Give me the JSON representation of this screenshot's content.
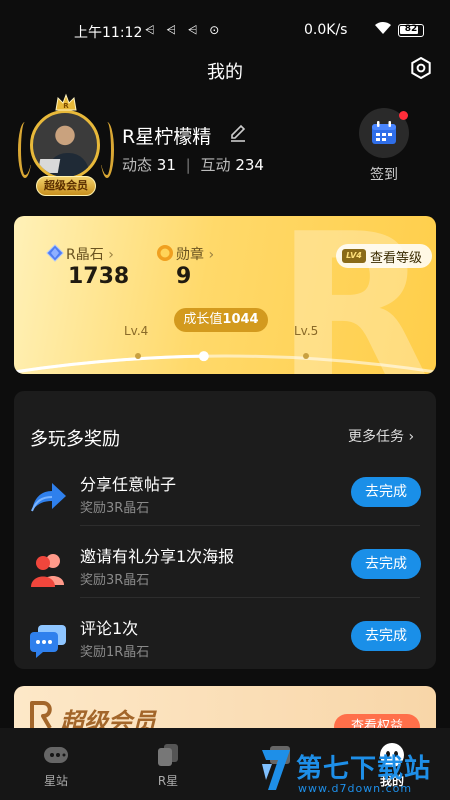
{
  "status_bar": {
    "time": "上午11:12",
    "notifications": "⩤ ⩤ ⩤ ⊙",
    "network_speed": "0.0K/s",
    "battery": "82",
    "battery_level": 0.82
  },
  "header": {
    "title": "我的"
  },
  "profile": {
    "username": "R星柠檬精",
    "badge": "超级会员",
    "stats": {
      "dongtai_label": "动态",
      "dongtai_value": "31",
      "hudong_label": "互动",
      "hudong_value": "234"
    },
    "signin_label": "签到"
  },
  "gold_card": {
    "gem_label": "R晶石",
    "gem_value": "1738",
    "medal_label": "勋章",
    "medal_value": "9",
    "level_badge": "LV4",
    "level_link": "查看等级",
    "growth_label": "成长值",
    "growth_value": "1044",
    "level_current": "Lv.4",
    "level_next": "Lv.5",
    "progress": 0.45
  },
  "tasks": {
    "title": "多玩多奖励",
    "more": "更多任务",
    "items": [
      {
        "title": "分享任意帖子",
        "reward": "奖励3R晶石",
        "button": "去完成",
        "icon": "share-icon"
      },
      {
        "title": "邀请有礼分享1次海报",
        "reward": "奖励3R晶石",
        "button": "去完成",
        "icon": "invite-users-icon"
      },
      {
        "title": "评论1次",
        "reward": "奖励1R晶石",
        "button": "去完成",
        "icon": "comment-icon"
      }
    ]
  },
  "vip_banner": {
    "title": "超级会员",
    "button": "查看权益"
  },
  "bottom_nav": {
    "items": [
      {
        "label": "星站"
      },
      {
        "label": "R星"
      },
      {
        "label": ""
      },
      {
        "label": "我的"
      }
    ]
  },
  "watermark": {
    "title": "第七下载站",
    "url": "www.d7down.com"
  },
  "colors": {
    "accent": "#1a8fe8",
    "gold": "#ffd96a",
    "notification_red": "#ff2d3a"
  }
}
